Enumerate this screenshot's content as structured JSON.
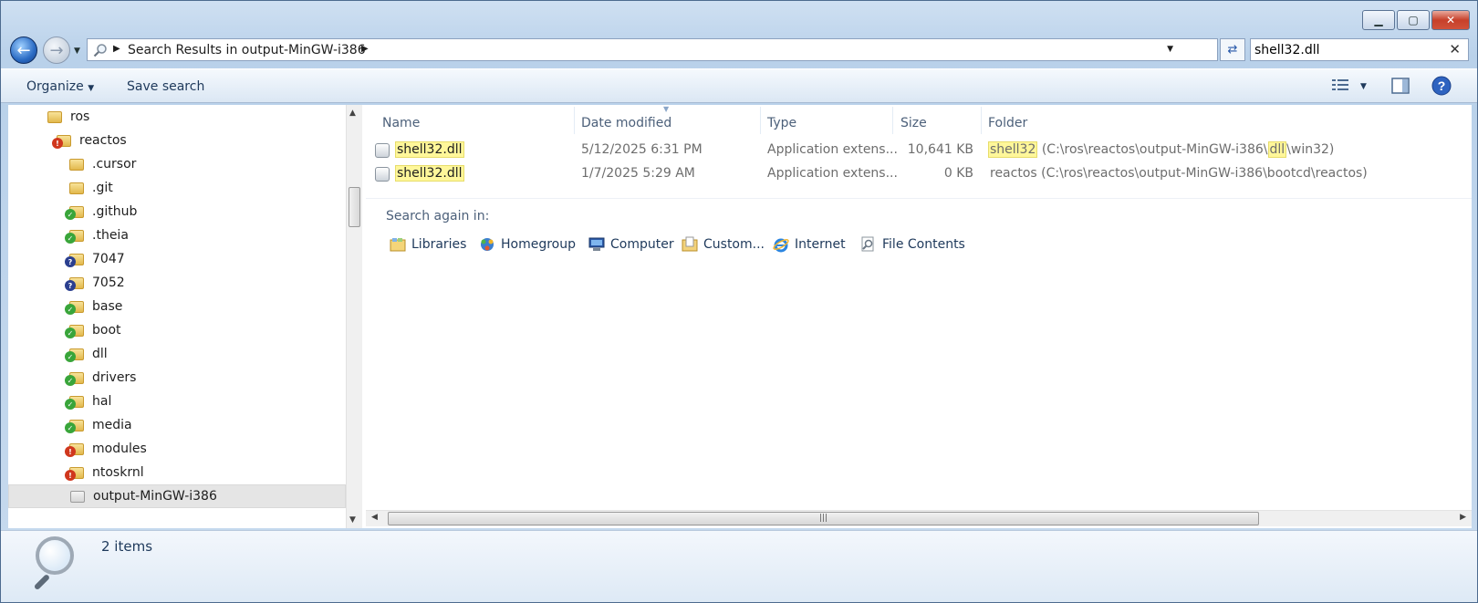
{
  "window": {
    "controls": {
      "minimize": "▁",
      "maximize": "▢",
      "close": "✕"
    }
  },
  "navigation": {
    "back_icon": "back-arrow-icon",
    "forward_icon": "forward-arrow-icon",
    "address": "Search Results in output-MinGW-i386",
    "search_value": "shell32.dll"
  },
  "toolbar": {
    "organize": "Organize",
    "save_search": "Save search"
  },
  "nav_tree": [
    {
      "label": "ros",
      "overlay": "none"
    },
    {
      "label": "reactos",
      "overlay": "error"
    },
    {
      "label": ".cursor",
      "overlay": "none"
    },
    {
      "label": ".git",
      "overlay": "none"
    },
    {
      "label": ".github",
      "overlay": "ok"
    },
    {
      "label": ".theia",
      "overlay": "ok"
    },
    {
      "label": "7047",
      "overlay": "unknown"
    },
    {
      "label": "7052",
      "overlay": "unknown"
    },
    {
      "label": "base",
      "overlay": "ok"
    },
    {
      "label": "boot",
      "overlay": "ok"
    },
    {
      "label": "dll",
      "overlay": "ok"
    },
    {
      "label": "drivers",
      "overlay": "ok"
    },
    {
      "label": "hal",
      "overlay": "ok"
    },
    {
      "label": "media",
      "overlay": "ok"
    },
    {
      "label": "modules",
      "overlay": "error"
    },
    {
      "label": "ntoskrnl",
      "overlay": "error"
    },
    {
      "label": "output-MinGW-i386",
      "overlay": "none",
      "selected": true
    }
  ],
  "columns": {
    "name": "Name",
    "date": "Date modified",
    "type": "Type",
    "size": "Size",
    "folder": "Folder"
  },
  "files": [
    {
      "name": "shell32.dll",
      "date": "5/12/2025 6:31 PM",
      "type": "Application extens...",
      "size": "10,641 KB",
      "folder_prefix": "shell32",
      "folder_mid": " (C:\\ros\\reactos\\output-MinGW-i386\\",
      "folder_hl": "dll",
      "folder_suffix": "\\win32)"
    },
    {
      "name": "shell32.dll",
      "date": "1/7/2025 5:29 AM",
      "type": "Application extens...",
      "size": "0 KB",
      "folder": "reactos (C:\\ros\\reactos\\output-MinGW-i386\\bootcd\\reactos)"
    }
  ],
  "search_again": {
    "label": "Search again in:",
    "locations": [
      "Libraries",
      "Homegroup",
      "Computer",
      "Custom...",
      "Internet",
      "File Contents"
    ]
  },
  "details": {
    "count": "2 items"
  }
}
